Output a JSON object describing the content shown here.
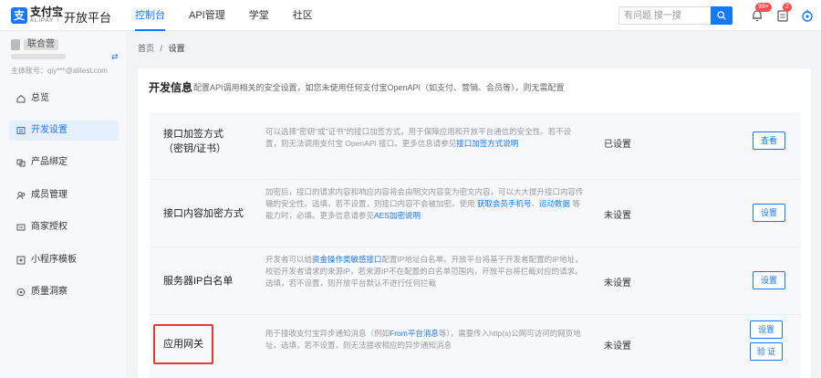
{
  "brand": {
    "logo_glyph": "支",
    "name_cn": "支付宝",
    "name_en": "ALIPAY",
    "platform": "开放平台"
  },
  "topnav": {
    "items": [
      {
        "label": "控制台",
        "active": true
      },
      {
        "label": "API管理"
      },
      {
        "label": "学堂"
      },
      {
        "label": "社区"
      }
    ]
  },
  "search": {
    "placeholder": "有问题 搜一搜"
  },
  "header_icons": {
    "notification_badge": "99+",
    "task_badge": "2"
  },
  "user": {
    "name": "联合营",
    "switch_icon": "⇄",
    "account": "主体账号：qiy***@alitest.com"
  },
  "sidebar": {
    "items": [
      {
        "label": "总览",
        "icon": "home-icon"
      },
      {
        "label": "开发设置",
        "icon": "settings-icon",
        "active": true
      },
      {
        "label": "产品绑定",
        "icon": "product-icon"
      },
      {
        "label": "成员管理",
        "icon": "members-icon"
      },
      {
        "label": "商家授权",
        "icon": "authorize-icon"
      },
      {
        "label": "小程序模板",
        "icon": "template-icon"
      },
      {
        "label": "质量洞察",
        "icon": "insight-icon"
      }
    ]
  },
  "breadcrumb": {
    "home": "首页",
    "sep": "/",
    "current": "设置"
  },
  "dev_info": {
    "title": "开发信息",
    "description": "配置API调用相关的安全设置，如您未使用任何支付宝OpenAPI（如支付、营销、会员等），则无需配置",
    "rows": [
      {
        "label_line1": "接口加签方式",
        "label_line2": "（密钥/证书）",
        "desc_text": "可以选择\"密钥\"或\"证书\"的接口加签方式，用于保障应用和开放平台通信的安全性。若不设置，则无法调用支付宝 OpenAPI 接口。更多信息请参见",
        "desc_link": "接口加签方式说明",
        "status": "已设置",
        "button": "查看"
      },
      {
        "label_line1": "接口内容加密方式",
        "desc_text": "加密后，接口的请求内容和响应内容将会由明文内容变为密文内容，可以大大提升接口内容传输的安全性。选填，若不设置，则接口内容不会被加密。使用",
        "desc_link": "获取会员手机号",
        "desc_sep": "、",
        "desc_link2": "运动数据",
        "desc_text2": "等能力时，必填。更多信息请参见",
        "desc_link3": "AES加密说明",
        "status": "未设置",
        "button": "设置"
      },
      {
        "label_line1": "服务器IP白名单",
        "desc_text": "开发者可以给",
        "desc_link": "资金操作类敏感接口",
        "desc_text2": "配置IP地址白名单。开放平台将基于开发者配置的IP地址，校验开发者请求的来源IP，若来源IP不在配置的白名单范围内，开放平台将拦截对应的请求。选填，若不设置，则开放平台默认不进行任何拦截",
        "status": "未设置",
        "button": "设置"
      },
      {
        "label_line1": "应用网关",
        "desc_text": "用于接收支付宝异步通知消息（例如",
        "desc_link": "From平台消息",
        "desc_text2": "等），需要传入http(s)公网可访问的网页地址。选填，若不设置，则无法接收相应的异步通知消息",
        "status": "未设置",
        "button": "设置",
        "button2": "验 证"
      }
    ]
  }
}
